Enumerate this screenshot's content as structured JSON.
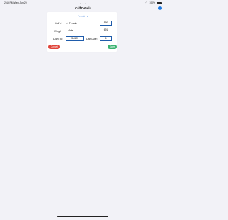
{
  "status_bar": {
    "time": "2:44 PM  Wed Jun 29",
    "battery_label": "100%",
    "top_dots": "• • •"
  },
  "nav": {
    "title": "Calf Details",
    "info_icon": "info-icon",
    "info_glyph": "i"
  },
  "form": {
    "picker_top_label": "Female ∨",
    "calf_label": "Calf #",
    "calf_value": "560",
    "weight_label": "Weigh",
    "weight_value": "691",
    "dam_id_label": "Dam ID:",
    "dam_id_value": "SN125",
    "dam_age_label": "Dam Age:",
    "dam_age_value": "5"
  },
  "sex_menu": {
    "options": [
      "✓ Female",
      "Male"
    ]
  },
  "buttons": {
    "cancel": "Cancel",
    "save": "Save"
  },
  "colors": {
    "accent": "#1f7ae0",
    "cancel": "#e0453b",
    "save": "#3cb371"
  }
}
